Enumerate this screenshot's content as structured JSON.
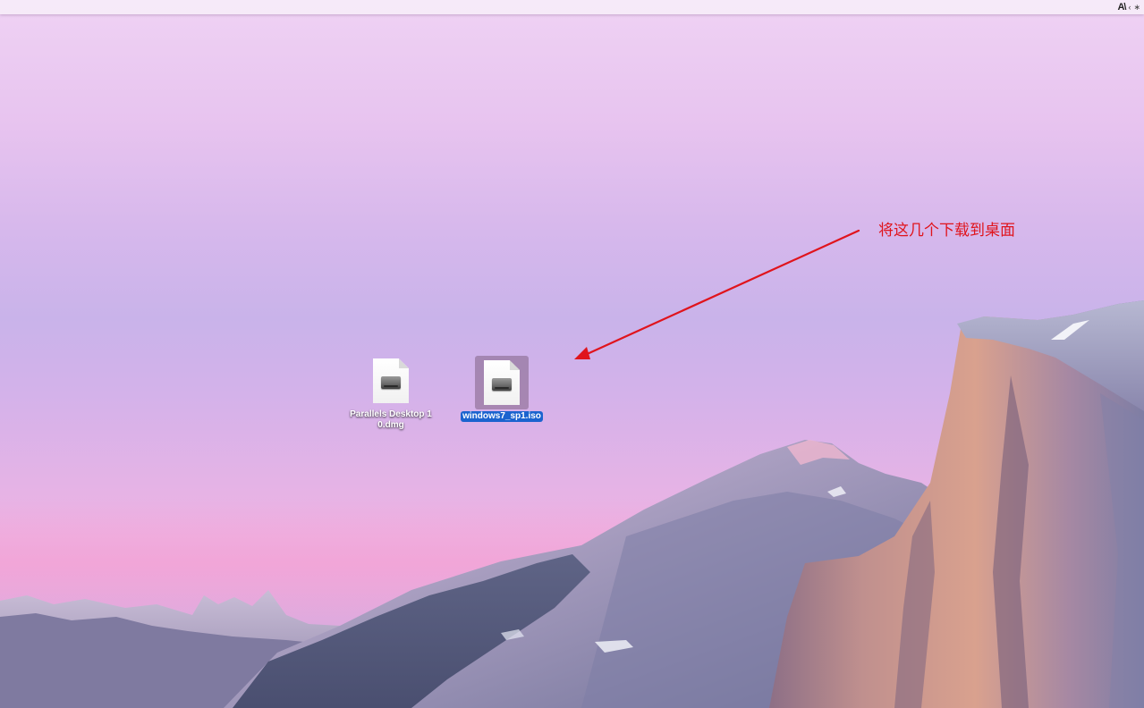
{
  "menubar": {
    "status_icons": [
      "adobe-icon",
      "script-menu-icon",
      "bluetooth-icon"
    ],
    "adobe_glyph": "A\\",
    "script_glyph": "‹",
    "bluetooth_glyph": "∗"
  },
  "desktop": {
    "items": [
      {
        "name": "Parallels Desktop 10.dmg",
        "icon": "disk-image-file-icon",
        "selected": false
      },
      {
        "name": "windows7_sp1.iso",
        "icon": "disk-image-file-icon",
        "selected": true
      }
    ]
  },
  "annotation": {
    "text": "将这几个下载到桌面",
    "color": "#e0141c"
  },
  "colors": {
    "selection": "#1b63cf",
    "annotation_red": "#e0141c"
  }
}
